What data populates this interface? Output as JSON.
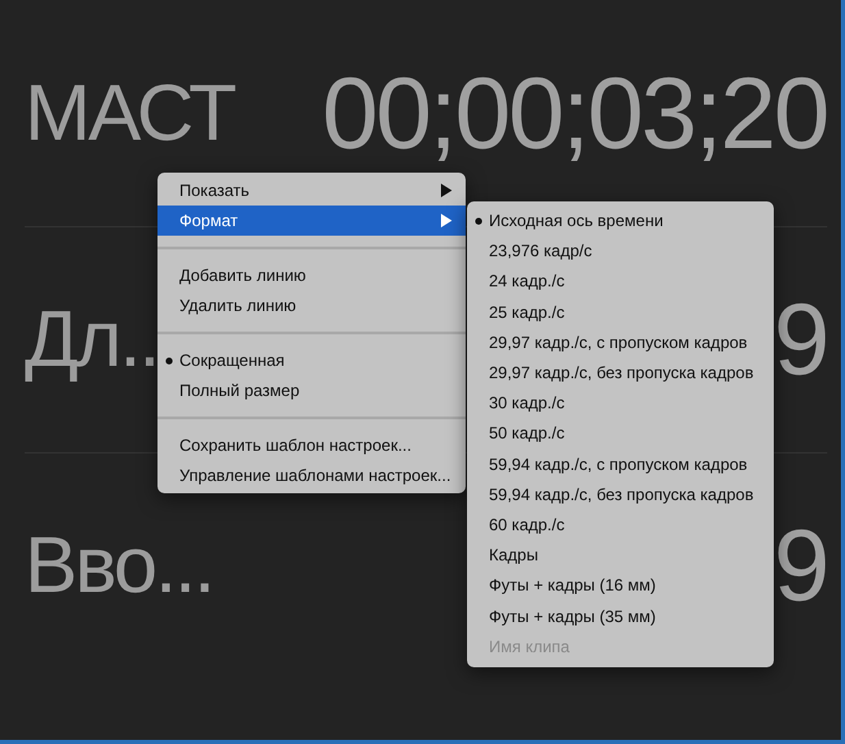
{
  "rows": [
    {
      "label": "МАСТ",
      "value": "00;00;03;20"
    },
    {
      "label": "Дл..",
      "value": "9"
    },
    {
      "label": "Вво...",
      "value": "9"
    }
  ],
  "context_menu": {
    "groups": [
      [
        {
          "label": "Показать",
          "selected": false,
          "submenu": true,
          "checked": false
        },
        {
          "label": "Формат",
          "selected": true,
          "submenu": true,
          "checked": false
        }
      ],
      [
        {
          "label": "Добавить линию",
          "selected": false,
          "submenu": false,
          "checked": false
        },
        {
          "label": "Удалить линию",
          "selected": false,
          "submenu": false,
          "checked": false
        }
      ],
      [
        {
          "label": "Сокращенная",
          "selected": false,
          "submenu": false,
          "checked": true
        },
        {
          "label": "Полный размер",
          "selected": false,
          "submenu": false,
          "checked": false
        }
      ],
      [
        {
          "label": "Сохранить шаблон настроек...",
          "selected": false,
          "submenu": false,
          "checked": false
        },
        {
          "label": "Управление шаблонами настроек...",
          "selected": false,
          "submenu": false,
          "checked": false
        }
      ]
    ]
  },
  "submenu": {
    "items": [
      {
        "label": "Исходная ось времени",
        "checked": true,
        "disabled": false
      },
      {
        "label": "23,976 кадр/с",
        "checked": false,
        "disabled": false
      },
      {
        "label": "24 кадр./с",
        "checked": false,
        "disabled": false
      },
      {
        "label": "25 кадр./с",
        "checked": false,
        "disabled": false
      },
      {
        "label": "29,97 кадр./с, с пропуском кадров",
        "checked": false,
        "disabled": false
      },
      {
        "label": "29,97 кадр./с, без пропуска кадров",
        "checked": false,
        "disabled": false
      },
      {
        "label": "30 кадр./с",
        "checked": false,
        "disabled": false
      },
      {
        "label": "50 кадр./с",
        "checked": false,
        "disabled": false
      },
      {
        "label": "59,94 кадр./с, с пропуском кадров",
        "checked": false,
        "disabled": false
      },
      {
        "label": "59,94 кадр./с, без пропуска кадров",
        "checked": false,
        "disabled": false
      },
      {
        "label": "60 кадр./с",
        "checked": false,
        "disabled": false
      },
      {
        "label": "Кадры",
        "checked": false,
        "disabled": false
      },
      {
        "label": "Футы + кадры (16 мм)",
        "checked": false,
        "disabled": false
      },
      {
        "label": "Футы + кадры (35 мм)",
        "checked": false,
        "disabled": false
      },
      {
        "label": "Имя клипа",
        "checked": false,
        "disabled": true
      }
    ]
  }
}
